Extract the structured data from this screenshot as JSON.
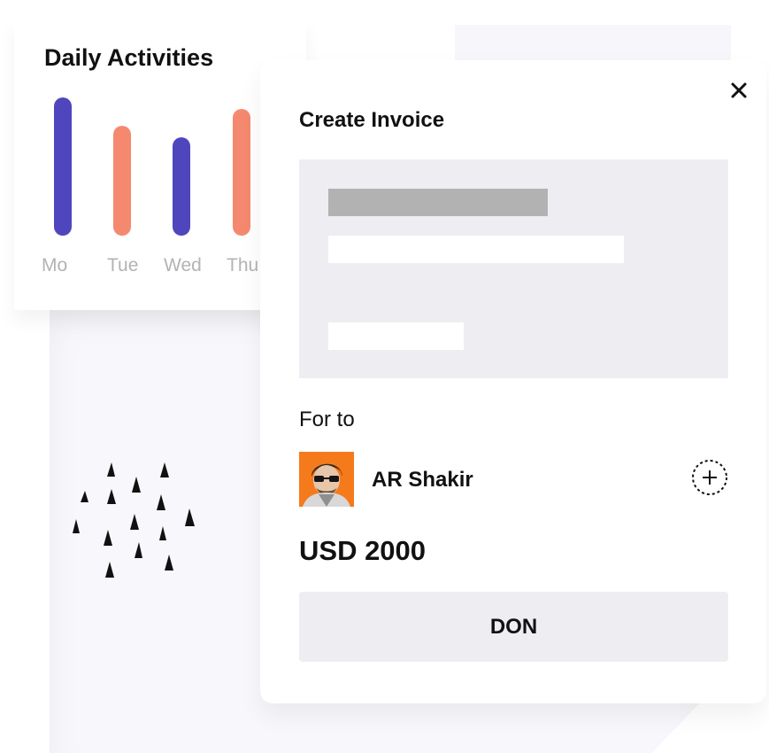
{
  "daily_activities": {
    "title": "Daily Activities",
    "days": [
      "Mo",
      "Tue",
      "Wed",
      "Thu"
    ],
    "bar_levels": [
      1.0,
      0.79,
      0.7,
      0.9
    ],
    "bar_colors": [
      "#4f46bd",
      "#f5896f",
      "#4f46bd",
      "#f5896f"
    ]
  },
  "invoice": {
    "title": "Create Invoice",
    "for_label": "For to",
    "recipient_name": "AR Shakir",
    "amount": "USD 2000",
    "done_label": "DON"
  },
  "icons": {
    "close": "close-icon",
    "add": "add-circle-icon",
    "avatar": "user-avatar"
  },
  "colors": {
    "accent_purple": "#4f46bd",
    "accent_orange": "#f5896f",
    "avatar_bg": "#f57a1c",
    "panel_gray": "#eeedf2"
  }
}
